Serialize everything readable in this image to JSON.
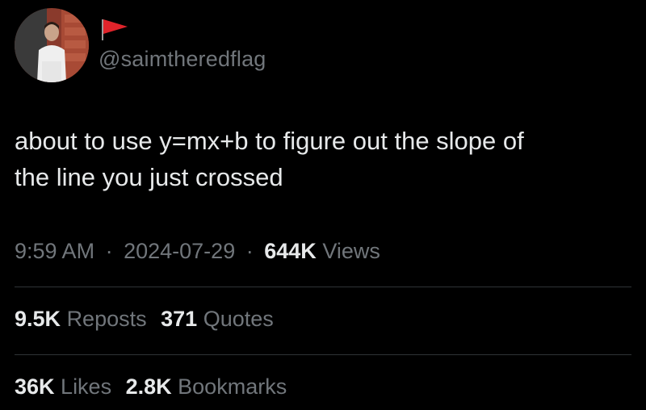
{
  "author": {
    "handle": "@saimtheredflag",
    "avatar_icon": "profile-photo",
    "flag_icon": "red-flag-icon",
    "flag_color": "#e0242b"
  },
  "tweet": {
    "lines": [
      "about to use y=mx+b to figure out the slope of",
      "the line you just crossed"
    ]
  },
  "meta": {
    "time": "9:59 AM",
    "separator": "·",
    "date": "2024-07-29",
    "views_count": "644K",
    "views_label": "Views"
  },
  "stats": {
    "reposts_count": "9.5K",
    "reposts_label": "Reposts",
    "quotes_count": "371",
    "quotes_label": "Quotes",
    "likes_count": "36K",
    "likes_label": "Likes",
    "bookmarks_count": "2.8K",
    "bookmarks_label": "Bookmarks"
  },
  "colors": {
    "background": "#000000",
    "text_primary": "#e7e9ea",
    "text_secondary": "#71767b",
    "divider": "#2f3336"
  }
}
